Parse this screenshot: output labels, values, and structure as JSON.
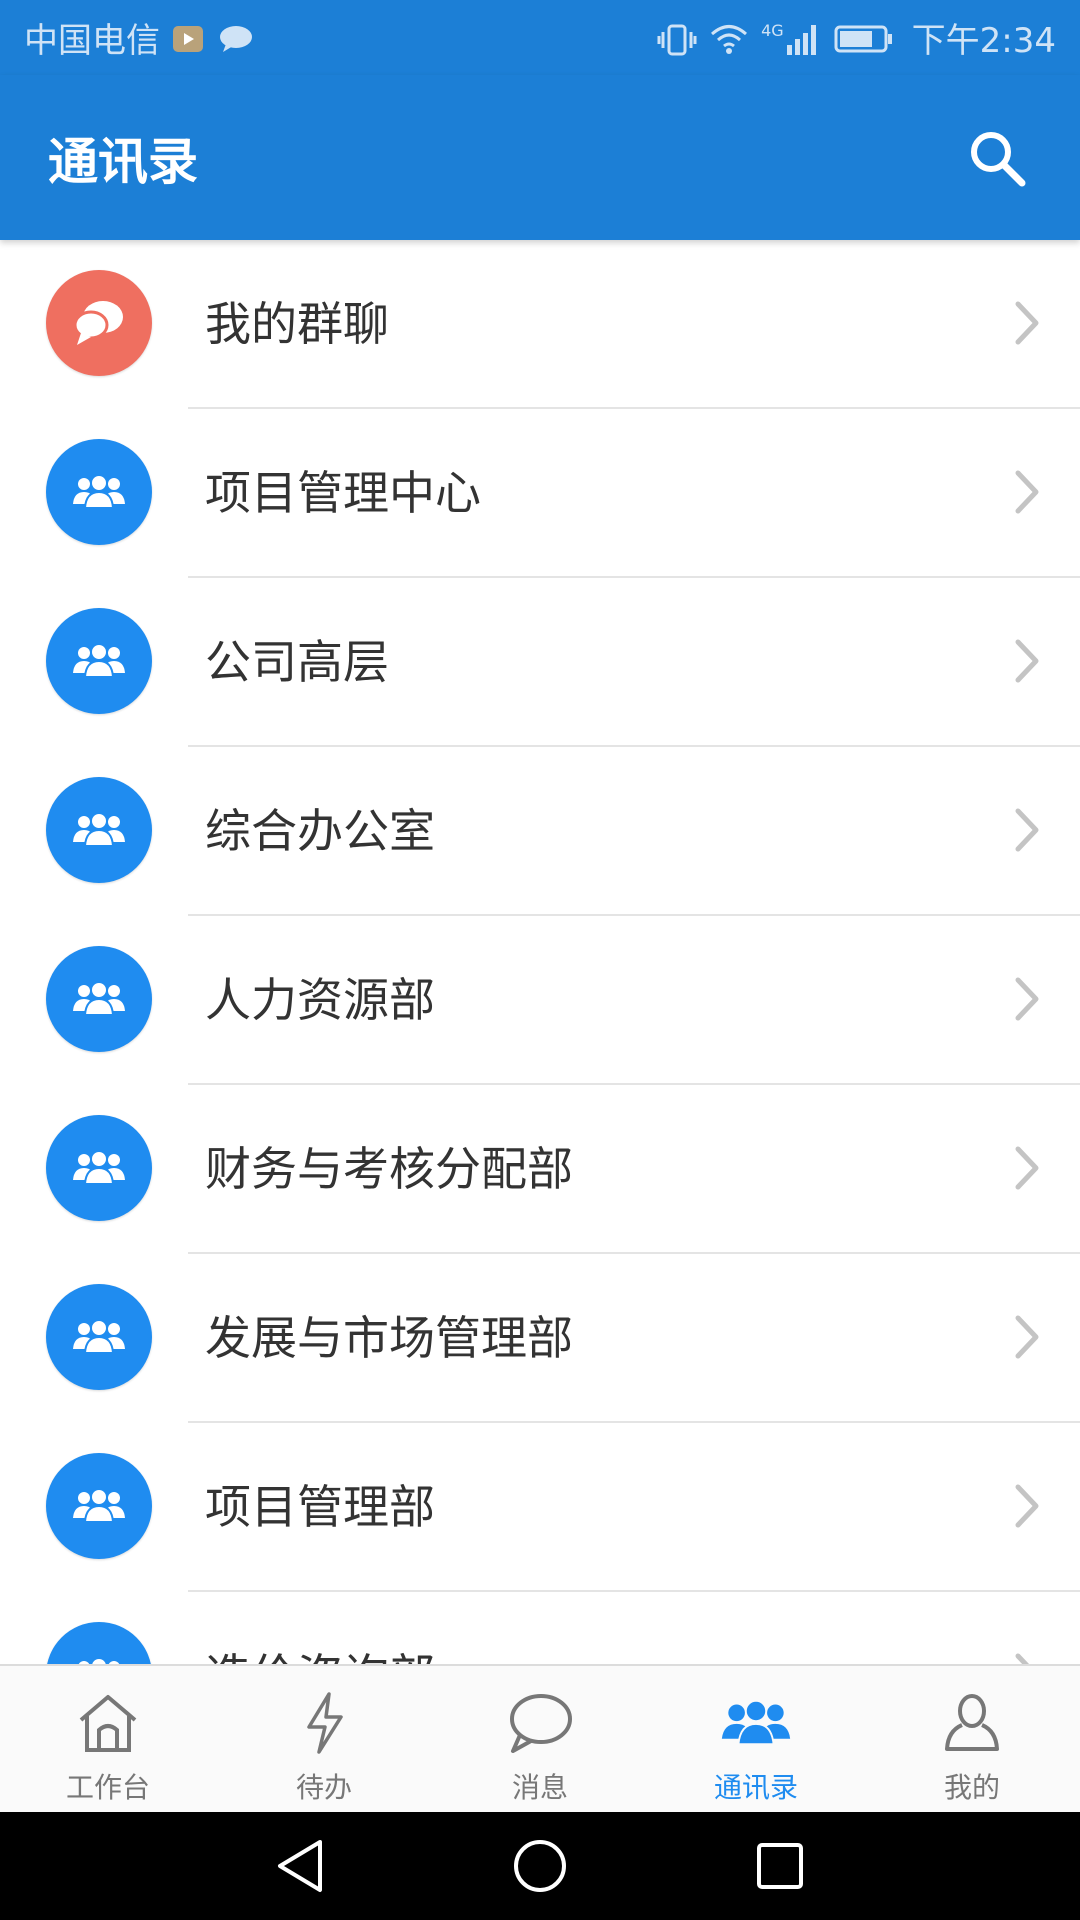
{
  "status_bar": {
    "carrier": "中国电信",
    "network": "4G",
    "time": "下午2:34"
  },
  "app_bar": {
    "title": "通讯录"
  },
  "contacts": {
    "items": [
      {
        "label": "我的群聊",
        "type": "chat"
      },
      {
        "label": "项目管理中心",
        "type": "group"
      },
      {
        "label": "公司高层",
        "type": "group"
      },
      {
        "label": "综合办公室",
        "type": "group"
      },
      {
        "label": "人力资源部",
        "type": "group"
      },
      {
        "label": "财务与考核分配部",
        "type": "group"
      },
      {
        "label": "发展与市场管理部",
        "type": "group"
      },
      {
        "label": "项目管理部",
        "type": "group"
      },
      {
        "label": "造价咨询部",
        "type": "group"
      }
    ]
  },
  "bottom_nav": {
    "items": [
      {
        "label": "工作台",
        "icon": "home-icon"
      },
      {
        "label": "待办",
        "icon": "lightning-icon"
      },
      {
        "label": "消息",
        "icon": "chat-bubble-icon"
      },
      {
        "label": "通讯录",
        "icon": "contacts-icon",
        "active": true
      },
      {
        "label": "我的",
        "icon": "person-icon"
      }
    ]
  },
  "colors": {
    "primary": "#1c7fd6",
    "group_avatar": "#1f8cf0",
    "chat_avatar": "#ef6f60",
    "active_tab": "#1f8cf0"
  }
}
